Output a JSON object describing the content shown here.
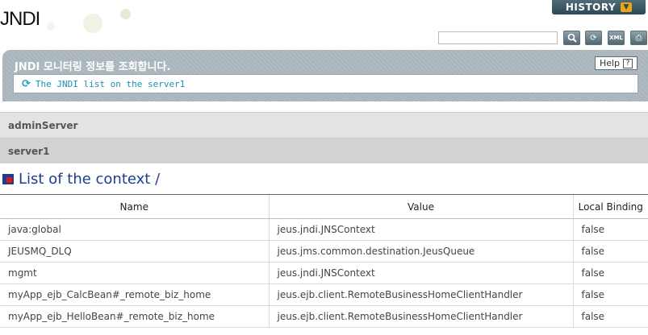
{
  "header": {
    "title": "JNDI",
    "history_label": "HISTORY",
    "search_placeholder": ""
  },
  "info": {
    "title": "JNDI 모니터링 정보를 조회합니다.",
    "help_label": "Help",
    "message": "The JNDI list on the server1"
  },
  "servers": [
    {
      "label": "adminServer"
    },
    {
      "label": "server1"
    }
  ],
  "section": {
    "title": "List of the context /"
  },
  "table": {
    "headers": {
      "name": "Name",
      "value": "Value",
      "binding": "Local Binding"
    },
    "rows": [
      {
        "name": "java:global",
        "value": "jeus.jndi.JNSContext",
        "binding": "false"
      },
      {
        "name": "JEUSMQ_DLQ",
        "value": "jeus.jms.common.destination.JeusQueue",
        "binding": "false"
      },
      {
        "name": "mgmt",
        "value": "jeus.jndi.JNSContext",
        "binding": "false"
      },
      {
        "name": "myApp_ejb_CalcBean#_remote_biz_home",
        "value": "jeus.ejb.client.RemoteBusinessHomeClientHandler",
        "binding": "false"
      },
      {
        "name": "myApp_ejb_HelloBean#_remote_biz_home",
        "value": "jeus.ejb.client.RemoteBusinessHomeClientHandler",
        "binding": "false"
      }
    ]
  },
  "colors": {
    "accent": "#1f3c8f",
    "panel": "#a8b4bb",
    "history": "#2f4754",
    "info_text": "#1a8fb0"
  },
  "icons": {
    "history": "chevron-down-icon",
    "search": "search-icon",
    "refresh": "refresh-icon",
    "xml": "xml-icon",
    "export": "export-icon",
    "help": "help-icon",
    "section": "context-list-icon"
  }
}
